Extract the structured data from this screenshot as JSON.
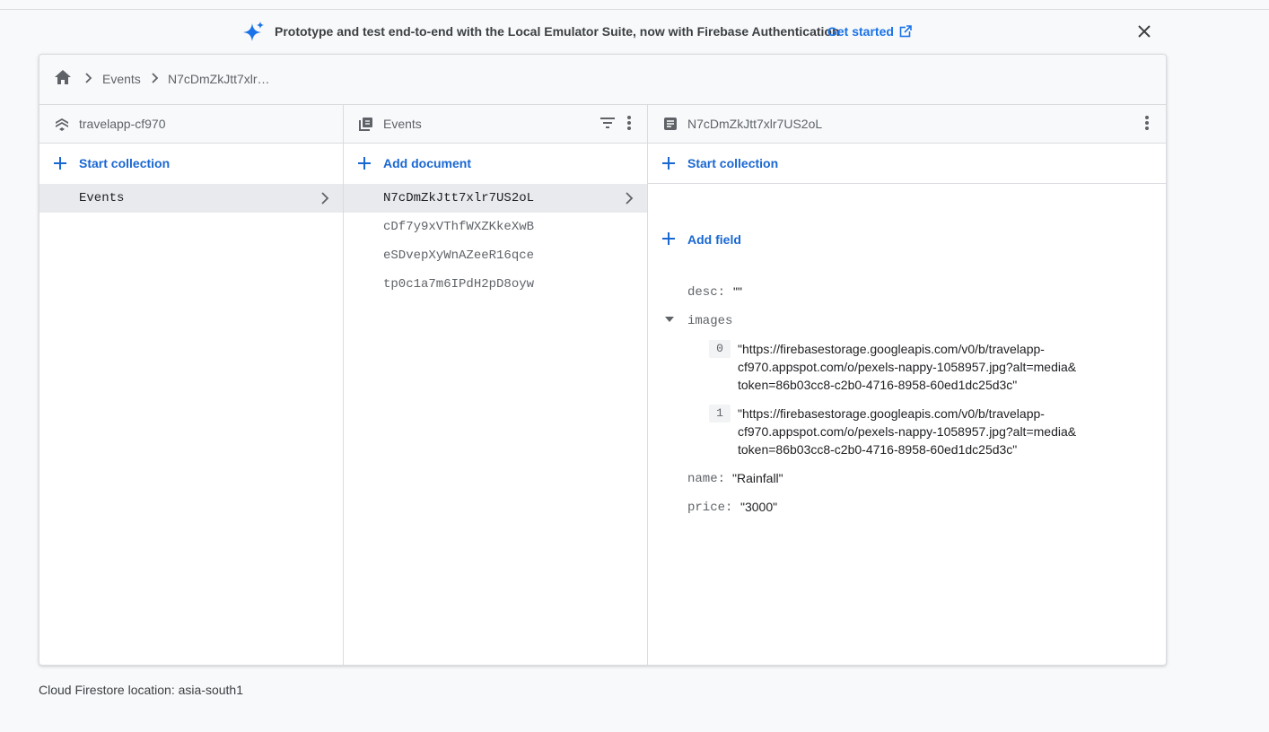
{
  "banner": {
    "message": "Prototype and test end-to-end with the Local Emulator Suite, now with Firebase Authentication",
    "cta": "Get started",
    "icons": [
      "sparkle-icon",
      "open-in-new-icon",
      "close-icon"
    ],
    "accent": "#1a73e8"
  },
  "breadcrumb": {
    "items": [
      "Events",
      "N7cDmZkJtt7xlr…"
    ]
  },
  "columns": {
    "project": {
      "title": "travelapp-cf970",
      "add_label": "Start collection",
      "items": [
        "Events"
      ]
    },
    "collection": {
      "title": "Events",
      "add_label": "Add document",
      "items": [
        "N7cDmZkJtt7xlr7US2oL",
        "cDf7y9xVThfWXZKkeXwB",
        "eSDvepXyWnAZeeR16qce",
        "tp0c1a7m6IPdH2pD8oyw"
      ]
    },
    "document": {
      "title": "N7cDmZkJtt7xlr7US2oL",
      "add_collection_label": "Start collection",
      "add_field_label": "Add field",
      "fields": {
        "desc": {
          "key": "desc:",
          "value": "\"\""
        },
        "images": {
          "key": "images",
          "entries": [
            {
              "index": "0",
              "lines": [
                "\"https://firebasestorage.googleapis.com/v0/b/travelapp-",
                "cf970.appspot.com/o/pexels-nappy-1058957.jpg?alt=media&",
                "token=86b03cc8-c2b0-4716-8958-60ed1dc25d3c\""
              ]
            },
            {
              "index": "1",
              "lines": [
                "\"https://firebasestorage.googleapis.com/v0/b/travelapp-",
                "cf970.appspot.com/o/pexels-nappy-1058957.jpg?alt=media&",
                "token=86b03cc8-c2b0-4716-8958-60ed1dc25d3c\""
              ]
            }
          ]
        },
        "name": {
          "key": "name:",
          "value": "\"Rainfall\""
        },
        "price": {
          "key": "price:",
          "value": "\"3000\""
        }
      }
    }
  },
  "footer": {
    "text": "Cloud Firestore location: asia-south1"
  }
}
